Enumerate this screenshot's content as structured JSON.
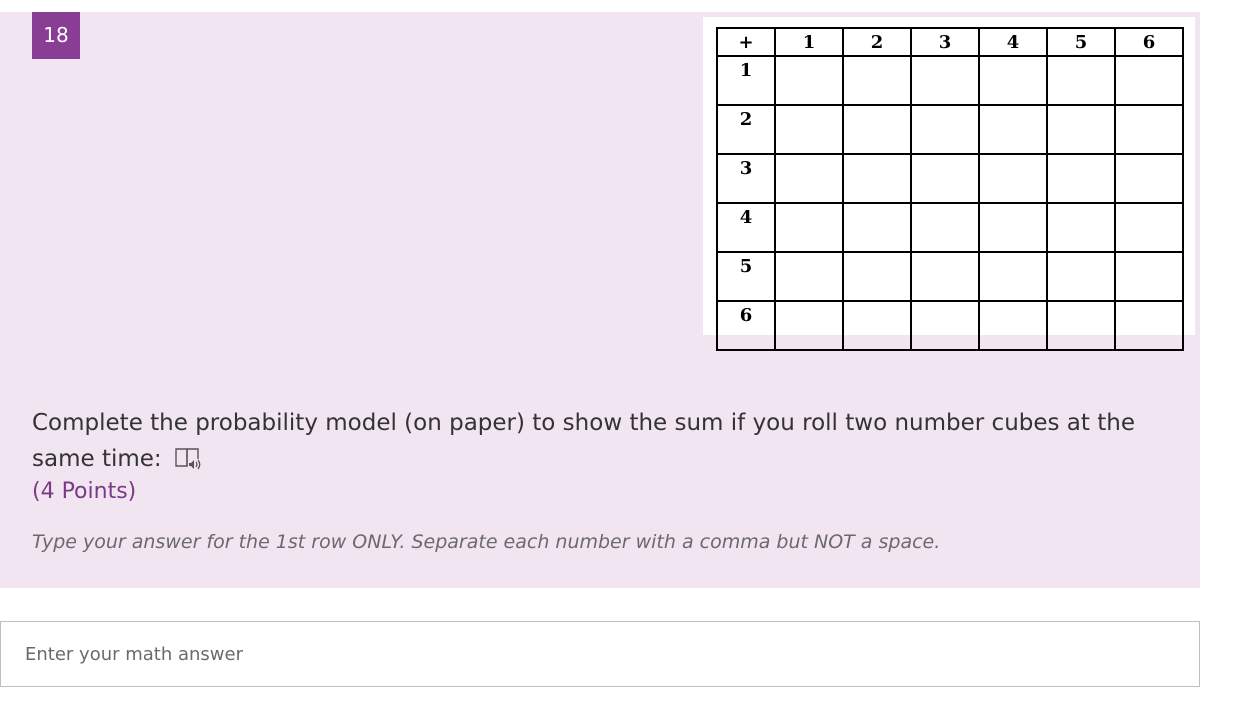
{
  "question": {
    "number": "18",
    "prompt": "Complete the probability model (on paper) to show the sum if you roll two number cubes at the same time:",
    "points": "(4 Points)",
    "subtitle": "Type your answer for the 1st row ONLY.  Separate each number with a comma but NOT a space.",
    "reader_icon": "immersive-reader-icon"
  },
  "table": {
    "corner": "+",
    "columns": [
      "1",
      "2",
      "3",
      "4",
      "5",
      "6"
    ],
    "rows": [
      "1",
      "2",
      "3",
      "4",
      "5",
      "6"
    ]
  },
  "answer": {
    "placeholder": "Enter your math answer",
    "value": ""
  },
  "colors": {
    "card_background": "#f1e5f2",
    "accent": "#8a3d94",
    "points_text": "#7b3a86"
  }
}
